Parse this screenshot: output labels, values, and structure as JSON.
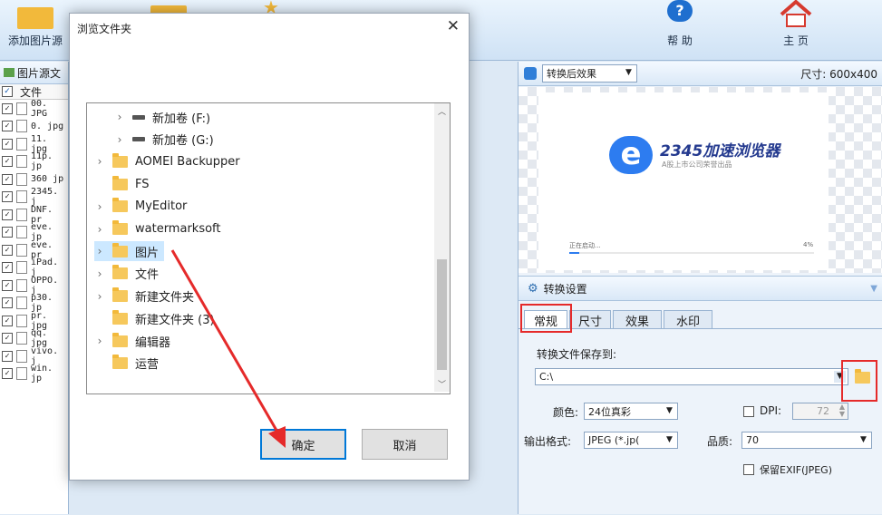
{
  "toolbar": {
    "add_images_label": "添加图片源",
    "help_label": "帮 助",
    "home_label": "主 页"
  },
  "left_panel": {
    "title": "图片源文",
    "column_header": "文件",
    "files": [
      "00. JPG",
      "0. jpg",
      "11. jpg",
      "11p. jp",
      "360 jp",
      "2345. j",
      "DNF. pr",
      "eve. jp",
      "eve. pr",
      "iPad. j",
      "OPPO. j",
      "p30. jp",
      "pr. jpg",
      "qq. jpg",
      "vivo. j",
      "win. jp"
    ]
  },
  "preview": {
    "mode_selected": "转换后效果",
    "size_text": "尺寸: 600x400",
    "splash_brand": "2345加速浏览器",
    "splash_tagline": "A股上市公司荣誉出品",
    "splash_status": "正在启动...",
    "splash_percent": "4%",
    "splash_progress": 0.04
  },
  "settings": {
    "title": "转换设置",
    "tabs": [
      "常规",
      "尺寸",
      "效果",
      "水印"
    ],
    "active_tab": "常规",
    "save_to_label": "转换文件保存到:",
    "save_path": "C:\\",
    "color_label": "颜色:",
    "color_value": "24位真彩",
    "dpi_label": "DPI:",
    "dpi_value": "72",
    "format_label": "输出格式:",
    "format_value": "JPEG (*.jp(",
    "quality_label": "品质:",
    "quality_value": "70",
    "exif_label": "保留EXIF(JPEG)"
  },
  "dialog": {
    "title": "浏览文件夹",
    "tree": [
      {
        "label": "新加卷 (F:)",
        "type": "drive",
        "level": 1,
        "expandable": true
      },
      {
        "label": "新加卷 (G:)",
        "type": "drive",
        "level": 1,
        "expandable": true
      },
      {
        "label": "AOMEI Backupper",
        "type": "folder",
        "level": 0,
        "expandable": true
      },
      {
        "label": "FS",
        "type": "folder",
        "level": 0,
        "expandable": false
      },
      {
        "label": "MyEditor",
        "type": "folder",
        "level": 0,
        "expandable": true
      },
      {
        "label": "watermarksoft",
        "type": "folder",
        "level": 0,
        "expandable": true
      },
      {
        "label": "图片",
        "type": "folder",
        "level": 0,
        "expandable": true,
        "selected": true
      },
      {
        "label": "文件",
        "type": "folder",
        "level": 0,
        "expandable": true
      },
      {
        "label": "新建文件夹",
        "type": "folder",
        "level": 0,
        "expandable": true
      },
      {
        "label": "新建文件夹 (3)",
        "type": "folder",
        "level": 0,
        "expandable": false
      },
      {
        "label": "编辑器",
        "type": "folder",
        "level": 0,
        "expandable": true
      },
      {
        "label": "运营",
        "type": "folder",
        "level": 0,
        "expandable": false
      }
    ],
    "ok_label": "确定",
    "cancel_label": "取消"
  },
  "colors": {
    "accent": "#0078d7",
    "highlight": "#e52a2a",
    "folder": "#f6c85c"
  }
}
